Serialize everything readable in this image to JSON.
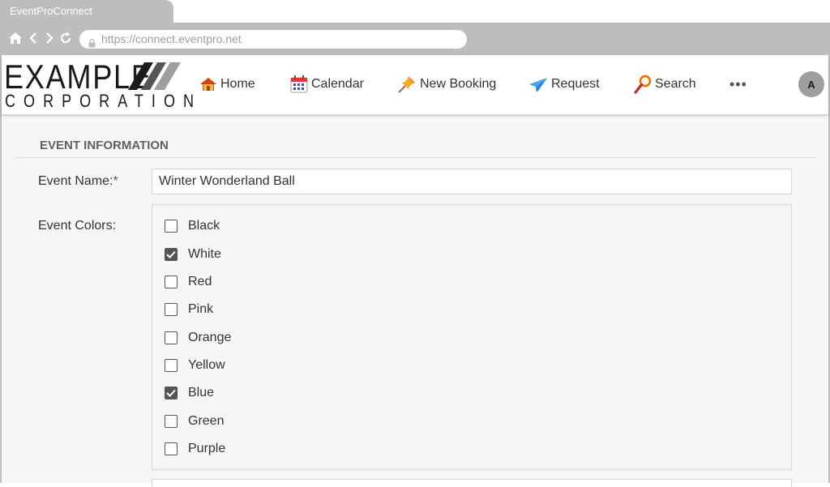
{
  "browser": {
    "tab_title": "EventProConnect",
    "url": "https://connect.eventpro.net"
  },
  "brand": {
    "logo_line1": "EXAMPLE",
    "logo_line2": "CORPORATION"
  },
  "nav": {
    "items": [
      {
        "label": "Home",
        "icon": "house-icon"
      },
      {
        "label": "Calendar",
        "icon": "calendar-icon"
      },
      {
        "label": "New Booking",
        "icon": "pushpin-icon"
      },
      {
        "label": "Request",
        "icon": "paper-plane-icon"
      },
      {
        "label": "Search",
        "icon": "magnifier-icon"
      }
    ],
    "more": "•••",
    "avatar_initial": "A"
  },
  "form": {
    "section_title": "EVENT INFORMATION",
    "event_name_label": "Event Name:",
    "required_marker": "*",
    "event_name_value": "Winter Wonderland Ball",
    "colors_label": "Event Colors:",
    "colors": [
      {
        "label": "Black",
        "checked": false
      },
      {
        "label": "White",
        "checked": true
      },
      {
        "label": "Red",
        "checked": false
      },
      {
        "label": "Pink",
        "checked": false
      },
      {
        "label": "Orange",
        "checked": false
      },
      {
        "label": "Yellow",
        "checked": false
      },
      {
        "label": "Blue",
        "checked": true
      },
      {
        "label": "Green",
        "checked": false
      },
      {
        "label": "Purple",
        "checked": false
      }
    ]
  },
  "theme": {
    "chrome_gray": "#bdbdbd",
    "required_color": "#2e7d32",
    "checkbox_checked": "#555555"
  }
}
